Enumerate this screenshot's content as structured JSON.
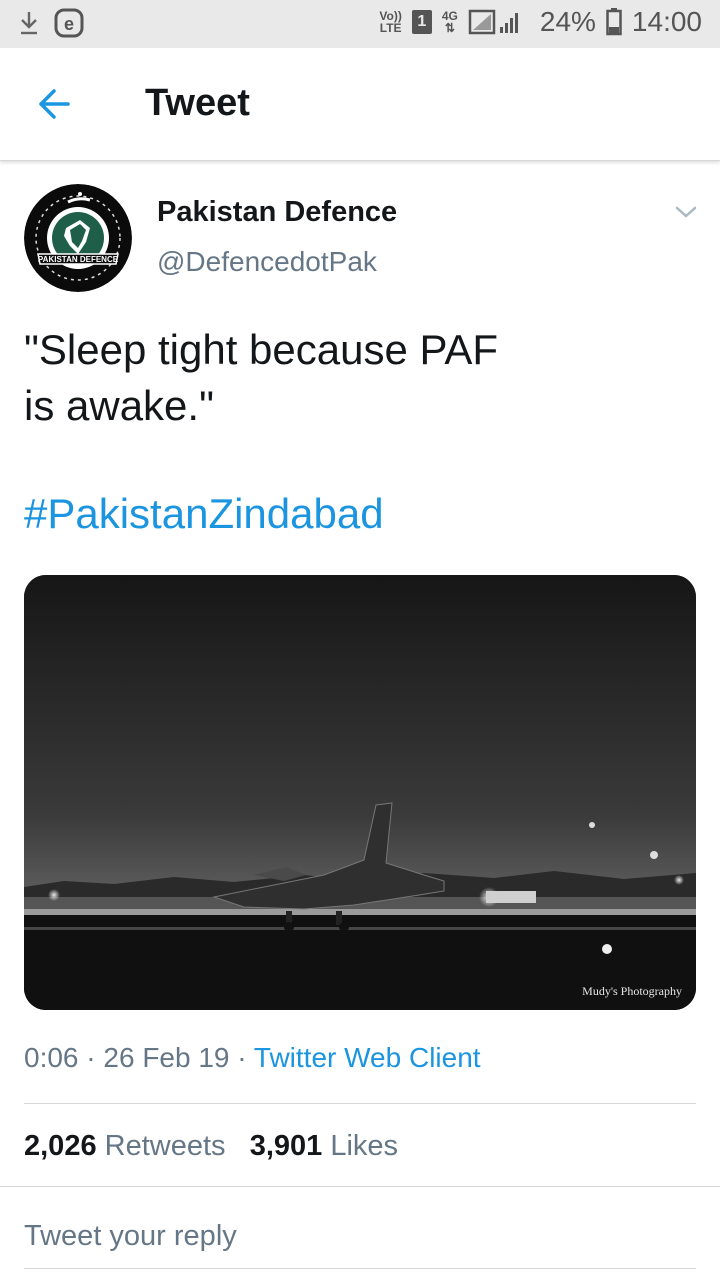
{
  "status_bar": {
    "volte_top": "Vo))",
    "volte_bottom": "LTE",
    "sim_slot": "1",
    "network_type": "4G",
    "battery": "24%",
    "time": "14:00",
    "icons": [
      "download-icon",
      "browser-e-icon",
      "signal-icon",
      "battery-icon"
    ]
  },
  "app_bar": {
    "title": "Tweet",
    "back_icon": "back-arrow-icon"
  },
  "tweet": {
    "author_name": "Pakistan Defence",
    "author_handle": "@DefencedotPak",
    "avatar_ring_text": "PAKISTAN DEFENCE",
    "text_lines": [
      "\"Sleep tight because PAF",
      "is awake.\""
    ],
    "hashtag": "#PakistanZindabad",
    "media_credit": "Mudy's Photography",
    "time": "0:06",
    "date": "26 Feb 19",
    "separator": "·",
    "client": "Twitter Web Client"
  },
  "stats": {
    "retweets_count": "2,026",
    "retweets_label": "Retweets",
    "likes_count": "3,901",
    "likes_label": "Likes"
  },
  "reply": {
    "placeholder": "Tweet your reply"
  },
  "colors": {
    "accent": "#1b95e0",
    "secondary_text": "#657786",
    "primary_text": "#14171a"
  }
}
